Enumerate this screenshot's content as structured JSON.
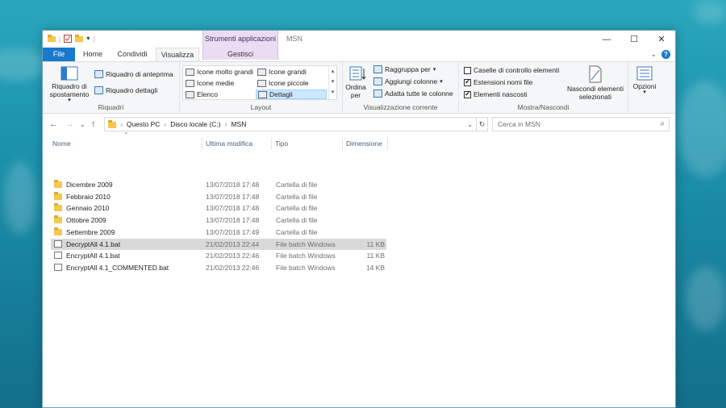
{
  "window": {
    "title": "MSN",
    "context_group": "Strumenti applicazioni",
    "controls": {
      "minimize": "—",
      "maximize": "☐",
      "close": "✕"
    }
  },
  "tabs": [
    {
      "label": "File"
    },
    {
      "label": "Home"
    },
    {
      "label": "Condividi"
    },
    {
      "label": "Visualizza"
    },
    {
      "label": "Gestisci"
    }
  ],
  "ribbon": {
    "riquadri": {
      "label": "Riquadri",
      "nav_pane": "Riquadro di spostamento",
      "preview_pane": "Riquadro di anteprima",
      "details_pane": "Riquadro dettagli"
    },
    "layout": {
      "label": "Layout",
      "items": [
        "Icone molto grandi",
        "Icone grandi",
        "Icone medie",
        "Icone piccole",
        "Elenco",
        "Dettagli"
      ],
      "selected": "Dettagli"
    },
    "current_view": {
      "label": "Visualizzazione corrente",
      "sort_by": "Ordina per",
      "group_by": "Raggruppa per",
      "add_columns": "Aggiungi colonne",
      "fit_columns": "Adatta tutte le colonne"
    },
    "show_hide": {
      "label": "Mostra/Nascondi",
      "checkboxes": [
        {
          "label": "Caselle di controllo elementi",
          "checked": false
        },
        {
          "label": "Estensioni nomi file",
          "checked": true
        },
        {
          "label": "Elementi nascosti",
          "checked": true
        }
      ],
      "hide_selected": "Nascondi elementi selezionati"
    },
    "options": "Opzioni"
  },
  "address": {
    "path": [
      "Questo PC",
      "Disco locale (C:)",
      "MSN"
    ],
    "search_placeholder": "Cerca in MSN"
  },
  "columns": [
    "Nome",
    "Ultima modifica",
    "Tipo",
    "Dimensione"
  ],
  "files": [
    {
      "name": "Dicembre 2009",
      "modified": "13/07/2018 17:48",
      "type": "Cartella di file",
      "size": "",
      "kind": "folder"
    },
    {
      "name": "Febbraio 2010",
      "modified": "13/07/2018 17:48",
      "type": "Cartella di file",
      "size": "",
      "kind": "folder"
    },
    {
      "name": "Gennaio 2010",
      "modified": "13/07/2018 17:48",
      "type": "Cartella di file",
      "size": "",
      "kind": "folder"
    },
    {
      "name": "Ottobre 2009",
      "modified": "13/07/2018 17:48",
      "type": "Cartella di file",
      "size": "",
      "kind": "folder"
    },
    {
      "name": "Settembre 2009",
      "modified": "13/07/2018 17:49",
      "type": "Cartella di file",
      "size": "",
      "kind": "folder"
    },
    {
      "name": "DecryptAll 4.1.bat",
      "modified": "21/02/2013 22:44",
      "type": "File batch Windows",
      "size": "11 KB",
      "kind": "bat",
      "selected": true
    },
    {
      "name": "EncryptAll 4.1.bat",
      "modified": "21/02/2013 22:46",
      "type": "File batch Windows",
      "size": "11 KB",
      "kind": "bat"
    },
    {
      "name": "EncryptAll 4.1_COMMENTED.bat",
      "modified": "21/02/2013 22:46",
      "type": "File batch Windows",
      "size": "14 KB",
      "kind": "bat"
    }
  ]
}
